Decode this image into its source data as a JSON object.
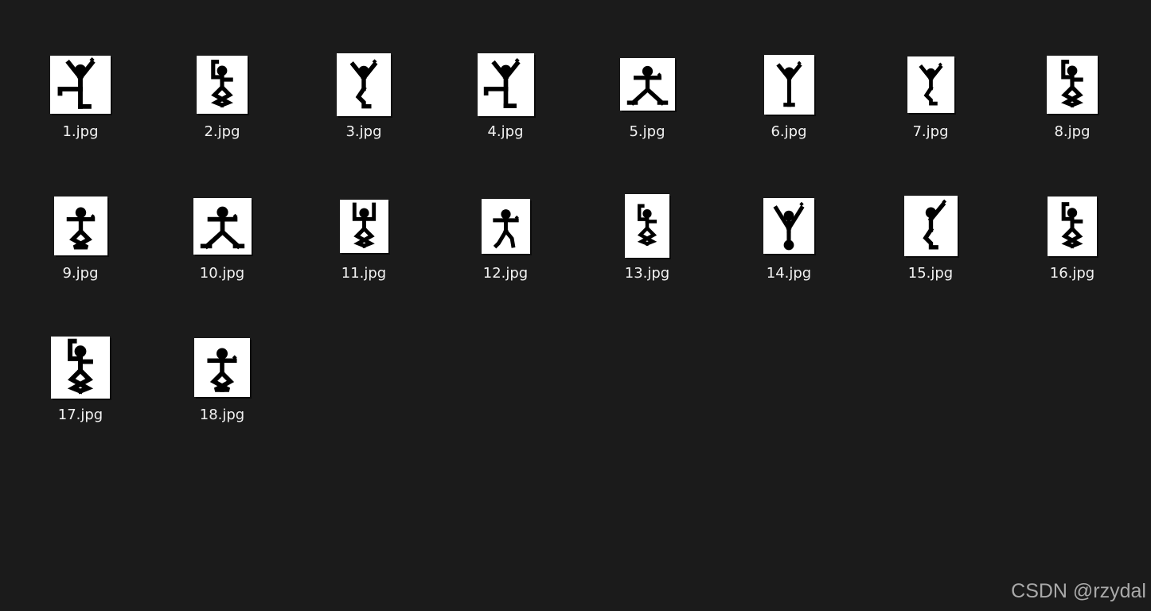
{
  "files": [
    {
      "name": "1.jpg",
      "icon": "dancing-man-icon",
      "pose": 1
    },
    {
      "name": "2.jpg",
      "icon": "dancing-man-icon",
      "pose": 2
    },
    {
      "name": "3.jpg",
      "icon": "dancing-man-icon",
      "pose": 3
    },
    {
      "name": "4.jpg",
      "icon": "dancing-man-icon",
      "pose": 4
    },
    {
      "name": "5.jpg",
      "icon": "dancing-man-icon",
      "pose": 5
    },
    {
      "name": "6.jpg",
      "icon": "dancing-man-icon",
      "pose": 6
    },
    {
      "name": "7.jpg",
      "icon": "dancing-man-icon",
      "pose": 7
    },
    {
      "name": "8.jpg",
      "icon": "dancing-man-icon",
      "pose": 8
    },
    {
      "name": "9.jpg",
      "icon": "dancing-man-icon",
      "pose": 9
    },
    {
      "name": "10.jpg",
      "icon": "dancing-man-icon",
      "pose": 10
    },
    {
      "name": "11.jpg",
      "icon": "dancing-man-icon",
      "pose": 11
    },
    {
      "name": "12.jpg",
      "icon": "dancing-man-icon",
      "pose": 12
    },
    {
      "name": "13.jpg",
      "icon": "dancing-man-icon",
      "pose": 13
    },
    {
      "name": "14.jpg",
      "icon": "dancing-man-icon",
      "pose": 14
    },
    {
      "name": "15.jpg",
      "icon": "dancing-man-icon",
      "pose": 15
    },
    {
      "name": "16.jpg",
      "icon": "dancing-man-icon",
      "pose": 16
    },
    {
      "name": "17.jpg",
      "icon": "dancing-man-icon",
      "pose": 17
    },
    {
      "name": "18.jpg",
      "icon": "dancing-man-icon",
      "pose": 18
    }
  ],
  "watermark": "CSDN @rzydal",
  "colors": {
    "background": "#1b1b1b",
    "thumbnail": "#ffffff",
    "figure": "#000000",
    "label": "#f2f2f2",
    "watermark": "#a9a9a9"
  }
}
